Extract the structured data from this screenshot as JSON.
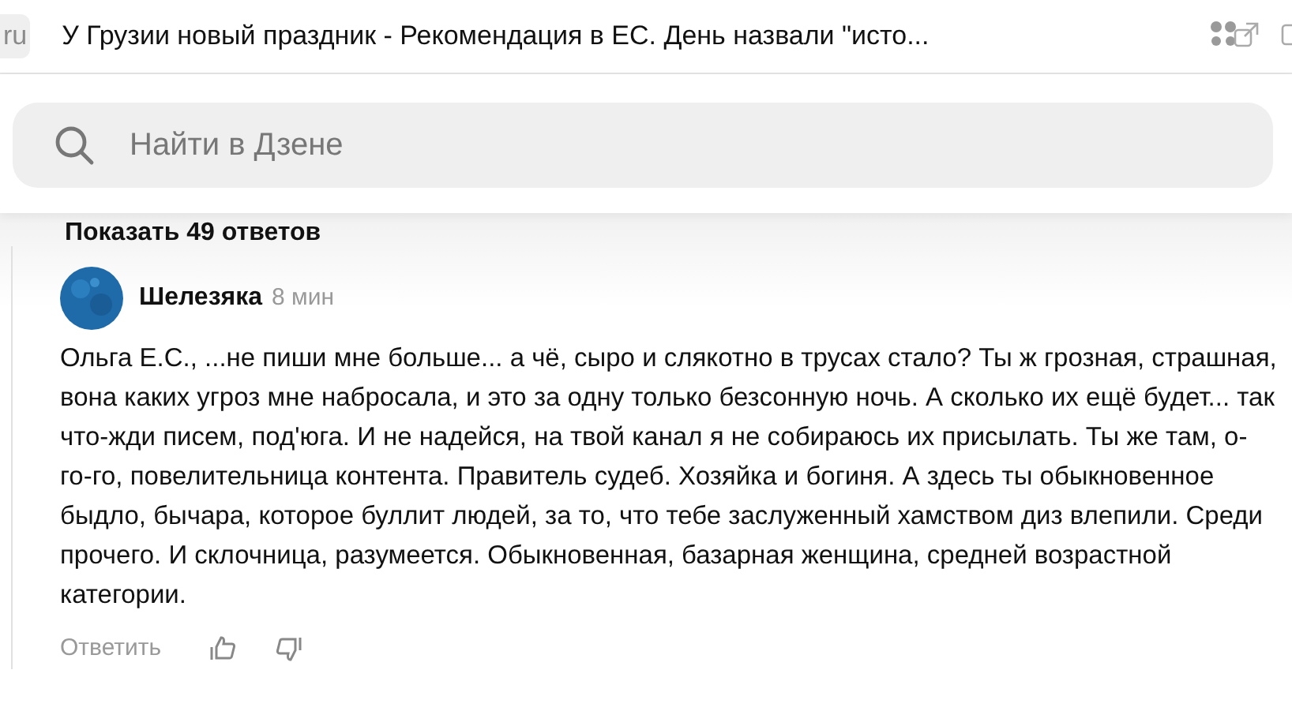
{
  "tab": {
    "domain": "ru",
    "title": "У Грузии новый праздник - Рекомендация в ЕС. День назвали \"исто..."
  },
  "search": {
    "placeholder": "Найти в Дзене"
  },
  "replies_link": "Показать 49 ответов",
  "comment": {
    "author": "Шелезяка",
    "time": "8 мин",
    "text": "Ольга Е.С., ...не пиши мне больше... а чё, сыро и слякотно в трусах стало? Ты ж грозная, страшная, вона каких угроз мне набросала, и это за одну только безсонную ночь. А сколько их ещё будет... так что-жди писем, под'юга. И не надейся, на твой канал я не собираюсь их присылать. Ты же там, о-го-го, повелительница контента. Правитель судеб. Хозяйка и богиня. А здесь ты обыкновенное быдло, бычара, которое буллит людей, за то, что тебе заслуженный хамством диз влепили. Среди прочего. И склочница, разумеется. Обыкновенная, базарная женщина, средней возрастной категории.",
    "reply": "Ответить"
  }
}
